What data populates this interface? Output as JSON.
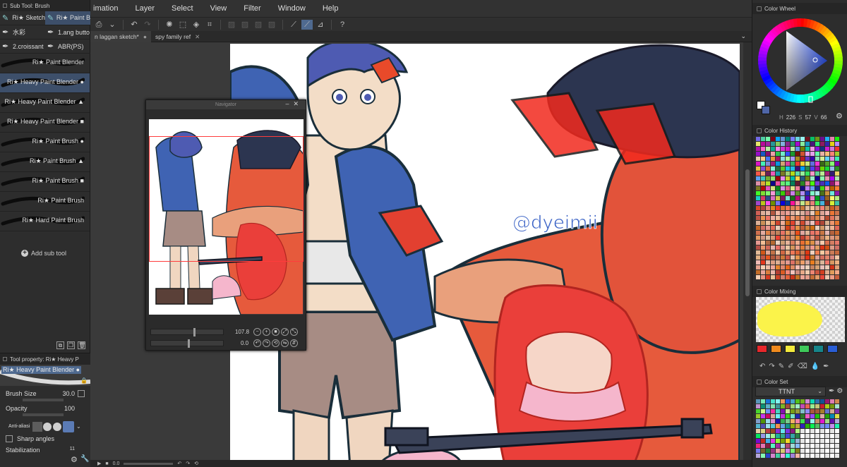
{
  "menubar": [
    "imation",
    "Layer",
    "Select",
    "View",
    "Filter",
    "Window",
    "Help"
  ],
  "doc_tabs": [
    {
      "label": "n laggan sketch*",
      "active": true
    },
    {
      "label": "spy family ref",
      "active": false
    }
  ],
  "subtool_panel": {
    "title": "Sub Tool: Brush",
    "groups": [
      {
        "label": "Ri★ Sketch",
        "active": false
      },
      {
        "label": "Ri★ Paint B",
        "active": true
      },
      {
        "label": "水彩",
        "active": false
      },
      {
        "label": "1.ang butto",
        "active": false
      },
      {
        "label": "2.croissant",
        "active": false
      },
      {
        "label": "ABR(PS)",
        "active": false
      }
    ],
    "brushes": [
      {
        "label": "Ri★ Paint Blender",
        "active": false
      },
      {
        "label": "Ri★ Heavy Paint Blender ●",
        "active": true
      },
      {
        "label": "Ri★ Heavy Paint Blender ▲",
        "active": false
      },
      {
        "label": "Ri★ Heavy Paint Blender ■",
        "active": false
      },
      {
        "label": "Ri★ Paint Brush ●",
        "active": false
      },
      {
        "label": "Ri★ Paint Brush ▲",
        "active": false
      },
      {
        "label": "Ri★ Paint Brush ■",
        "active": false
      },
      {
        "label": "Ri★ Paint Brush",
        "active": false
      },
      {
        "label": "Ri★ Hard Paint Brush",
        "active": false
      }
    ],
    "add_label": "Add sub tool"
  },
  "tool_property": {
    "title": "Tool property: Ri★ Heavy P",
    "preset_name": "Ri★ Heavy Paint Blender ●",
    "brush_size_label": "Brush Size",
    "brush_size_value": "30.0",
    "opacity_label": "Opacity",
    "opacity_value": "100",
    "antialias_label": "Anti-aliasi",
    "sharp_angles_label": "Sharp angles",
    "stabilization_label": "Stabilization",
    "stabilization_value": "11"
  },
  "navigator": {
    "title": "Navigator",
    "zoom_value": "107.8",
    "rotate_value": "0.0"
  },
  "statusbar": {
    "value": "0.0"
  },
  "right_panel": {
    "color_wheel_title": "Color Wheel",
    "hsv": {
      "h": "226",
      "s": "57",
      "v": "66"
    },
    "current_color": "#4f66a8",
    "color_history_title": "Color History",
    "color_mixing_title": "Color Mixing",
    "mixing_chips": [
      "#e8272b",
      "#f08a1e",
      "#f3ea3c",
      "#3ec95a",
      "#16858a",
      "#2a5ed6"
    ],
    "color_set_title": "Color Set",
    "color_set_name": "TTNT"
  },
  "artwork": {
    "watermark": "@dyeimii"
  }
}
